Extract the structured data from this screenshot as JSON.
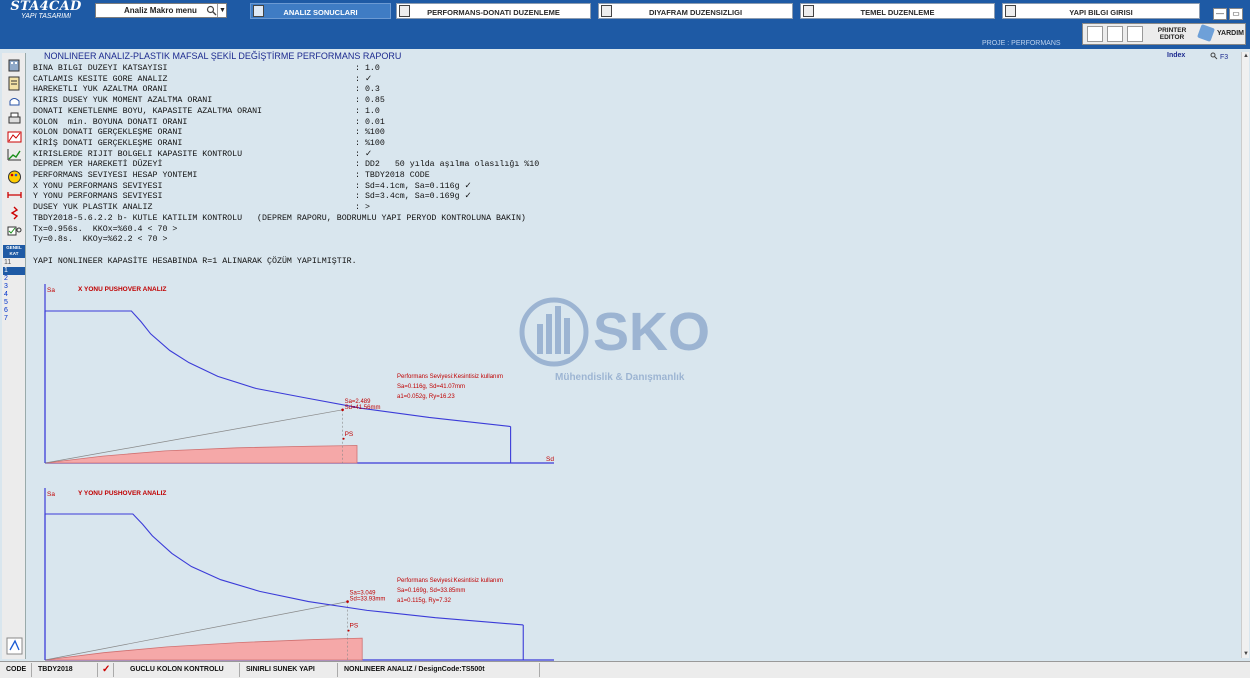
{
  "app": {
    "logo_title": "STA4CAD",
    "logo_subtitle": "YAPI TASARIMI"
  },
  "macro": {
    "label": "Analiz Makro menu"
  },
  "tabs": [
    {
      "label": "ANALIZ SONUCLARI",
      "active": true
    },
    {
      "label": "PERFORMANS-DONATI DUZENLEME",
      "active": false
    },
    {
      "label": "DIYAFRAM DUZENSIZLIGI",
      "active": false
    },
    {
      "label": "TEMEL DUZENLEME",
      "active": false
    },
    {
      "label": "YAPI BILGI GIRISI",
      "active": false
    }
  ],
  "window_buttons": {
    "minimize": "—",
    "restore": "▭",
    "close": "✕"
  },
  "proje_label": "PROJE : PERFORMANS",
  "toolbar": {
    "printer_editor": "PRINTER EDITOR",
    "help": "YARDIM"
  },
  "left": {
    "genel_kat": "GENEL KAT",
    "stories": [
      "11",
      "1",
      "2",
      "3",
      "4",
      "5",
      "6",
      "7"
    ],
    "selected_story": "1"
  },
  "report": {
    "title": "NONLINEER ANALIZ-PLASTIK MAFSAL ŞEKİL DEĞİŞTİRME PERFORMANS RAPORU",
    "index_label": "Index",
    "f3_label": "F3",
    "rows": [
      {
        "label": "BINA BILGI DUZEYI KATSAYISI",
        "value": ": 1.0"
      },
      {
        "label": "CATLAMIS KESITE GORE ANALIZ",
        "value": ": ✓"
      },
      {
        "label": "HAREKETLI YUK AZALTMA ORANI",
        "value": ": 0.3"
      },
      {
        "label": "KIRIS DUSEY YUK MOMENT AZALTMA ORANI",
        "value": ": 0.85"
      },
      {
        "label": "DONATI KENETLENME BOYU, KAPASITE AZALTMA ORANI",
        "value": ": 1.0"
      },
      {
        "label": "KOLON  min. BOYUNA DONATI ORANI",
        "value": ": 0.01"
      },
      {
        "label": "KOLON DONATI GERÇEKLEŞME ORANI",
        "value": ": %100"
      },
      {
        "label": "KİRİŞ DONATI GERÇEKLEŞME ORANI",
        "value": ": %100"
      },
      {
        "label": "KIRISLERDE RIJIT BOLGELI KAPASITE KONTROLU",
        "value": ": ✓"
      },
      {
        "label": "DEPREM YER HAREKETİ DÜZEYİ",
        "value": ": DD2   50 yılda aşılma olasılığı %10"
      },
      {
        "label": "PERFORMANS SEVIYESI HESAP YONTEMI",
        "value": ": TBDY2018 CODE"
      },
      {
        "label": "X YONU PERFORMANS SEVIYESI",
        "value": ": Sd=4.1cm, Sa=0.116g ✓"
      },
      {
        "label": "Y YONU PERFORMANS SEVIYESI",
        "value": ": Sd=3.4cm, Sa=0.169g ✓"
      },
      {
        "label": "DUSEY YUK PLASTIK ANALIZ",
        "value": ": >"
      }
    ],
    "kutle_line": "TBDY2018-5.6.2.2 b- KUTLE KATILIM KONTROLU   (DEPREM RAPORU, BODRUMLU YAPI PERYOD KONTROLUNA BAKIN)",
    "tx_line": "Tx=0.956s.  KKOx=%60.4 < 70 >",
    "ty_line": "Ty=0.8s.  KKOy=%62.2 < 70 >",
    "r1_note": "YAPI NONLINEER KAPASİTE HESABINDA R=1 ALINARAK ÇÖZÜM YAPILMIŞTIR."
  },
  "chart_data": [
    {
      "type": "line",
      "title": "X YONU PUSHOVER ANALIZ",
      "xlabel": "Sd",
      "ylabel": "Sa",
      "demand_curve": {
        "x": [
          0,
          0.18,
          0.2,
          0.22,
          0.26,
          0.3,
          0.36,
          0.44,
          0.54,
          0.66,
          0.8,
          0.97
        ],
        "y": [
          1.0,
          1.0,
          0.93,
          0.85,
          0.74,
          0.66,
          0.57,
          0.49,
          0.43,
          0.36,
          0.3,
          0.24
        ]
      },
      "capacity_curve": {
        "x": [
          0,
          0.12,
          0.25,
          0.4,
          0.55,
          0.65
        ],
        "y": [
          0,
          0.045,
          0.08,
          0.1,
          0.11,
          0.115
        ]
      },
      "ps_label": "PS",
      "point_label": [
        "Sa=2.489",
        "Sd=41.56mm"
      ],
      "annotation": [
        "Performans Seviyesi:Kesintisiz kullanım",
        "Sa=0.116g, Sd=41.07mm",
        "a1=0.052g, Ry=16.23"
      ],
      "colors": {
        "demand": "#3b3bd8",
        "fill": "#f5a8a8",
        "label": "#c00000"
      }
    },
    {
      "type": "line",
      "title": "Y YONU PUSHOVER ANALIZ",
      "xlabel": "",
      "ylabel": "Sa",
      "demand_curve": {
        "x": [
          0,
          0.18,
          0.2,
          0.22,
          0.26,
          0.3,
          0.36,
          0.44,
          0.54,
          0.66,
          0.8,
          0.98
        ],
        "y": [
          1.0,
          1.0,
          0.93,
          0.85,
          0.73,
          0.64,
          0.55,
          0.47,
          0.4,
          0.34,
          0.29,
          0.24
        ]
      },
      "capacity_curve": {
        "x": [
          0,
          0.12,
          0.25,
          0.4,
          0.55,
          0.65
        ],
        "y": [
          0,
          0.05,
          0.09,
          0.12,
          0.14,
          0.15
        ]
      },
      "ps_label": "PS",
      "point_label": [
        "Sa=3.049",
        "Sd=33.93mm"
      ],
      "annotation": [
        "Performans Seviyesi:Kesintisiz kullanım",
        "Sa=0.169g, Sd=33.85mm",
        "a1=0.115g, Ry=7.32"
      ],
      "colors": {
        "demand": "#3b3bd8",
        "fill": "#f5a8a8",
        "label": "#c00000"
      }
    }
  ],
  "watermark": {
    "text": "SKO",
    "subtext": "Mühendislik & Danışmanlık"
  },
  "status": {
    "code": "CODE",
    "tbdy": "TBDY2018 CODE",
    "check": "✓",
    "guclu": "GUCLU KOLON KONTROLU",
    "sinirli": "SINIRLI SUNEK YAPI",
    "nonlin": "NONLINEER ANALIZ / DesignCode:TS500t"
  }
}
